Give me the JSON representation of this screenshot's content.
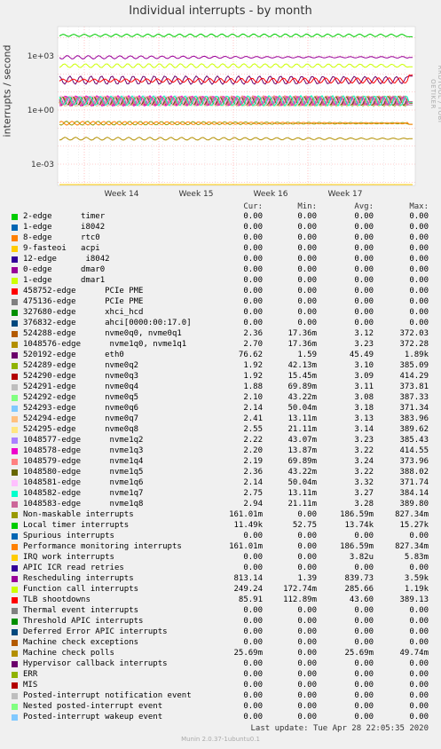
{
  "title": "Individual interrupts - by month",
  "side_label": "RRDTOOL / TOBI OETIKER",
  "ylabel": "interrupts / second",
  "headers": {
    "cur": "Cur:",
    "min": "Min:",
    "avg": "Avg:",
    "max": "Max:"
  },
  "last_update": "Last update: Tue Apr 28 22:05:35 2020",
  "version": "Munin 2.0.37-1ubuntu0.1",
  "chart_data": {
    "type": "line",
    "title": "Individual interrupts - by month",
    "ylabel": "interrupts / second",
    "yscale": "log",
    "yticks": [
      "1e+03",
      "1e+00",
      "1e-03"
    ],
    "ytick_values": [
      1000,
      1,
      0.001
    ],
    "xticks": [
      "Week 14",
      "Week 15",
      "Week 16",
      "Week 17"
    ],
    "grid": true,
    "series": [
      {
        "name": "2-edge      timer",
        "color": "#00cc00",
        "cur": "0.00",
        "min": "0.00",
        "avg": "0.00",
        "max": "0.00"
      },
      {
        "name": "1-edge      i8042",
        "color": "#0066b3",
        "cur": "0.00",
        "min": "0.00",
        "avg": "0.00",
        "max": "0.00"
      },
      {
        "name": "8-edge      rtc0",
        "color": "#ff8000",
        "cur": "0.00",
        "min": "0.00",
        "avg": "0.00",
        "max": "0.00"
      },
      {
        "name": "9-fasteoi   acpi",
        "color": "#ffcc00",
        "cur": "0.00",
        "min": "0.00",
        "avg": "0.00",
        "max": "0.00"
      },
      {
        "name": "12-edge      i8042",
        "color": "#330099",
        "cur": "0.00",
        "min": "0.00",
        "avg": "0.00",
        "max": "0.00"
      },
      {
        "name": "0-edge      dmar0",
        "color": "#990099",
        "cur": "0.00",
        "min": "0.00",
        "avg": "0.00",
        "max": "0.00"
      },
      {
        "name": "1-edge      dmar1",
        "color": "#ccff00",
        "cur": "0.00",
        "min": "0.00",
        "avg": "0.00",
        "max": "0.00"
      },
      {
        "name": "458752-edge      PCIe PME",
        "color": "#ff0000",
        "cur": "0.00",
        "min": "0.00",
        "avg": "0.00",
        "max": "0.00"
      },
      {
        "name": "475136-edge      PCIe PME",
        "color": "#808080",
        "cur": "0.00",
        "min": "0.00",
        "avg": "0.00",
        "max": "0.00"
      },
      {
        "name": "327680-edge      xhci_hcd",
        "color": "#008f00",
        "cur": "0.00",
        "min": "0.00",
        "avg": "0.00",
        "max": "0.00"
      },
      {
        "name": "376832-edge      ahci[0000:00:17.0]",
        "color": "#00487d",
        "cur": "0.00",
        "min": "0.00",
        "avg": "0.00",
        "max": "0.00"
      },
      {
        "name": "524288-edge      nvme0q0, nvme0q1",
        "color": "#b35a00",
        "cur": "2.36",
        "min": "17.36m",
        "avg": "3.12",
        "max": "372.03"
      },
      {
        "name": "1048576-edge      nvme1q0, nvme1q1",
        "color": "#b38f00",
        "cur": "2.70",
        "min": "17.36m",
        "avg": "3.23",
        "max": "372.28"
      },
      {
        "name": "520192-edge      eth0",
        "color": "#6b006b",
        "cur": "76.62",
        "min": "1.59",
        "avg": "45.49",
        "max": "1.89k"
      },
      {
        "name": "524289-edge      nvme0q2",
        "color": "#8fb300",
        "cur": "1.92",
        "min": "42.13m",
        "avg": "3.10",
        "max": "385.09"
      },
      {
        "name": "524290-edge      nvme0q3",
        "color": "#b30000",
        "cur": "1.92",
        "min": "15.45m",
        "avg": "3.09",
        "max": "414.29"
      },
      {
        "name": "524291-edge      nvme0q4",
        "color": "#bebebe",
        "cur": "1.88",
        "min": "69.89m",
        "avg": "3.11",
        "max": "373.81"
      },
      {
        "name": "524292-edge      nvme0q5",
        "color": "#80ff80",
        "cur": "2.10",
        "min": "43.22m",
        "avg": "3.08",
        "max": "387.33"
      },
      {
        "name": "524293-edge      nvme0q6",
        "color": "#80c9ff",
        "cur": "2.14",
        "min": "50.04m",
        "avg": "3.18",
        "max": "371.34"
      },
      {
        "name": "524294-edge      nvme0q7",
        "color": "#ffc080",
        "cur": "2.41",
        "min": "13.11m",
        "avg": "3.13",
        "max": "383.96"
      },
      {
        "name": "524295-edge      nvme0q8",
        "color": "#ffe680",
        "cur": "2.55",
        "min": "21.11m",
        "avg": "3.14",
        "max": "389.62"
      },
      {
        "name": "1048577-edge      nvme1q2",
        "color": "#aa80ff",
        "cur": "2.22",
        "min": "43.07m",
        "avg": "3.23",
        "max": "385.43"
      },
      {
        "name": "1048578-edge      nvme1q3",
        "color": "#ee00cc",
        "cur": "2.20",
        "min": "13.87m",
        "avg": "3.22",
        "max": "414.55"
      },
      {
        "name": "1048579-edge      nvme1q4",
        "color": "#ff8080",
        "cur": "2.19",
        "min": "69.89m",
        "avg": "3.24",
        "max": "373.96"
      },
      {
        "name": "1048580-edge      nvme1q5",
        "color": "#666600",
        "cur": "2.36",
        "min": "43.22m",
        "avg": "3.22",
        "max": "388.02"
      },
      {
        "name": "1048581-edge      nvme1q6",
        "color": "#ffbfff",
        "cur": "2.14",
        "min": "50.04m",
        "avg": "3.32",
        "max": "371.74"
      },
      {
        "name": "1048582-edge      nvme1q7",
        "color": "#00ffcc",
        "cur": "2.75",
        "min": "13.11m",
        "avg": "3.27",
        "max": "384.14"
      },
      {
        "name": "1048583-edge      nvme1q8",
        "color": "#cc6699",
        "cur": "2.94",
        "min": "21.11m",
        "avg": "3.28",
        "max": "389.80"
      },
      {
        "name": "Non-maskable interrupts",
        "color": "#999900",
        "cur": "161.01m",
        "min": "0.00",
        "avg": "186.59m",
        "max": "827.34m"
      },
      {
        "name": "Local timer interrupts",
        "color": "#00cc00",
        "cur": "11.49k",
        "min": "52.75",
        "avg": "13.74k",
        "max": "15.27k"
      },
      {
        "name": "Spurious interrupts",
        "color": "#0066b3",
        "cur": "0.00",
        "min": "0.00",
        "avg": "0.00",
        "max": "0.00"
      },
      {
        "name": "Performance monitoring interrupts",
        "color": "#ff8000",
        "cur": "161.01m",
        "min": "0.00",
        "avg": "186.59m",
        "max": "827.34m"
      },
      {
        "name": "IRQ work interrupts",
        "color": "#ffcc00",
        "cur": "0.00",
        "min": "0.00",
        "avg": "3.82u",
        "max": "5.83m"
      },
      {
        "name": "APIC ICR read retries",
        "color": "#330099",
        "cur": "0.00",
        "min": "0.00",
        "avg": "0.00",
        "max": "0.00"
      },
      {
        "name": "Rescheduling interrupts",
        "color": "#990099",
        "cur": "813.14",
        "min": "1.39",
        "avg": "839.73",
        "max": "3.59k"
      },
      {
        "name": "Function call interrupts",
        "color": "#ccff00",
        "cur": "249.24",
        "min": "172.74m",
        "avg": "285.66",
        "max": "1.19k"
      },
      {
        "name": "TLB shootdowns",
        "color": "#ff0000",
        "cur": "85.91",
        "min": "112.89m",
        "avg": "43.60",
        "max": "389.13"
      },
      {
        "name": "Thermal event interrupts",
        "color": "#808080",
        "cur": "0.00",
        "min": "0.00",
        "avg": "0.00",
        "max": "0.00"
      },
      {
        "name": "Threshold APIC interrupts",
        "color": "#008f00",
        "cur": "0.00",
        "min": "0.00",
        "avg": "0.00",
        "max": "0.00"
      },
      {
        "name": "Deferred Error APIC interrupts",
        "color": "#00487d",
        "cur": "0.00",
        "min": "0.00",
        "avg": "0.00",
        "max": "0.00"
      },
      {
        "name": "Machine check exceptions",
        "color": "#b35a00",
        "cur": "0.00",
        "min": "0.00",
        "avg": "0.00",
        "max": "0.00"
      },
      {
        "name": "Machine check polls",
        "color": "#b38f00",
        "cur": "25.69m",
        "min": "0.00",
        "avg": "25.69m",
        "max": "49.74m"
      },
      {
        "name": "Hypervisor callback interrupts",
        "color": "#6b006b",
        "cur": "0.00",
        "min": "0.00",
        "avg": "0.00",
        "max": "0.00"
      },
      {
        "name": "ERR",
        "color": "#8fb300",
        "cur": "0.00",
        "min": "0.00",
        "avg": "0.00",
        "max": "0.00"
      },
      {
        "name": "MIS",
        "color": "#b30000",
        "cur": "0.00",
        "min": "0.00",
        "avg": "0.00",
        "max": "0.00"
      },
      {
        "name": "Posted-interrupt notification event",
        "color": "#bebebe",
        "cur": "0.00",
        "min": "0.00",
        "avg": "0.00",
        "max": "0.00"
      },
      {
        "name": "Nested posted-interrupt event",
        "color": "#80ff80",
        "cur": "0.00",
        "min": "0.00",
        "avg": "0.00",
        "max": "0.00"
      },
      {
        "name": "Posted-interrupt wakeup event",
        "color": "#80c9ff",
        "cur": "0.00",
        "min": "0.00",
        "avg": "0.00",
        "max": "0.00"
      }
    ]
  }
}
